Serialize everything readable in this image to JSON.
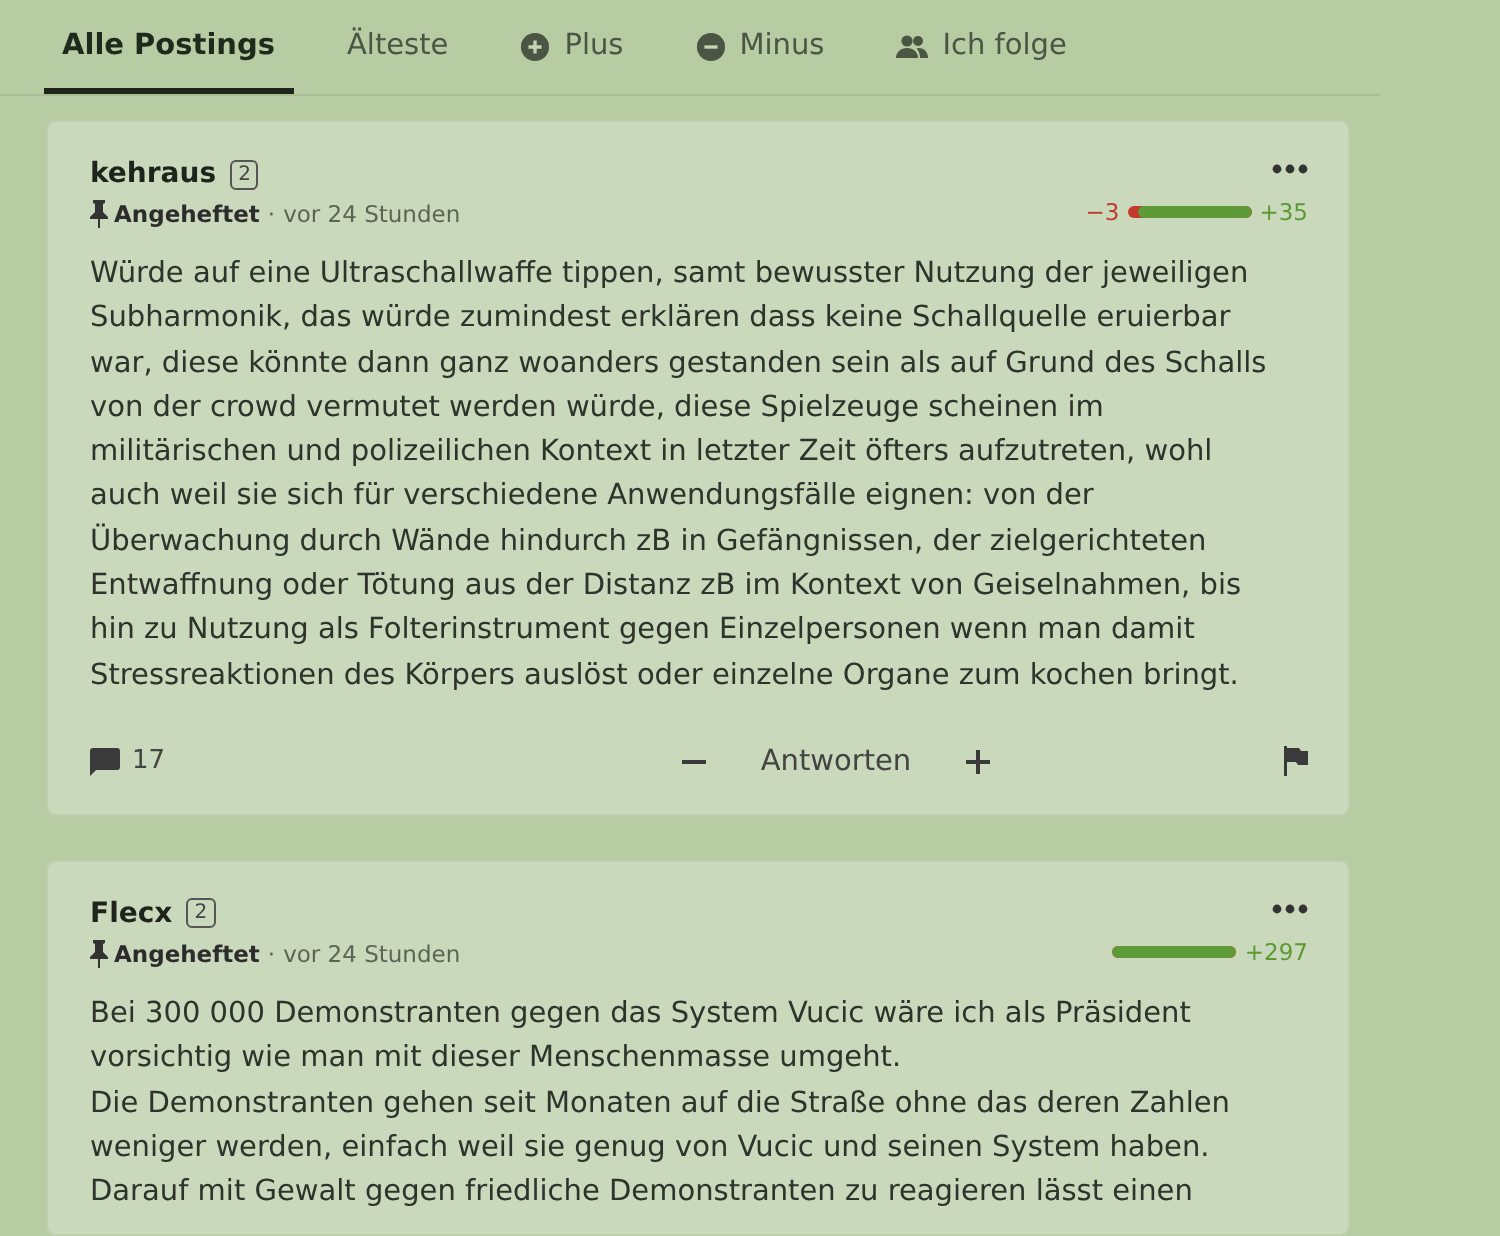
{
  "tabs": [
    {
      "label": "Alle Postings",
      "kind": "text",
      "selected": true
    },
    {
      "label": "Älteste",
      "kind": "text",
      "selected": false
    },
    {
      "label": "Plus",
      "kind": "plus",
      "selected": false
    },
    {
      "label": "Minus",
      "kind": "minus",
      "selected": false
    },
    {
      "label": "Ich folge",
      "kind": "people",
      "selected": false
    }
  ],
  "postings": [
    {
      "author": "kehraus",
      "badge": "2",
      "pinned": true,
      "pin_label": "Angeheftet",
      "separator": "·",
      "time": "vor 24 Stunden",
      "minus": "−3",
      "plus": "+35",
      "level": 0.92,
      "paragraphs": [
        "Würde auf eine Ultraschallwaffe tippen, samt bewusster Nutzung der jeweiligen Subharmonik, das würde zumindest erklären dass keine Schallquelle eruierbar war, diese könnte dann ganz woanders gestanden sein als auf Grund des Schalls von der crowd vermutet werden würde, diese Spielzeuge scheinen im militärischen und polizeilichen Kontext in letzter Zeit öfters aufzutreten, wohl auch weil sie sich für verschiedene Anwendungsfälle eignen: von der Überwachung durch Wände hindurch zB in Gefängnissen, der zielgerichteten Entwaffnung oder Tötung aus der Distanz zB im Kontext von Geiselnahmen, bis hin zu Nutzung als Folterinstrument gegen Einzelpersonen wenn man damit Stressreaktionen des Körpers auslöst oder einzelne Organe zum kochen bringt."
      ],
      "footer": {
        "comments": "17",
        "reply": "Antworten"
      }
    },
    {
      "author": "Flecx",
      "badge": "2",
      "pinned": true,
      "pin_label": "Angeheftet",
      "separator": "·",
      "time": "vor 24 Stunden",
      "plus": "+297",
      "level": 1,
      "paragraphs": [
        "Bei 300 000 Demonstranten gegen das System Vucic wäre ich als Präsident vorsichtig wie man mit dieser Menschenmasse umgeht.",
        "Die Demonstranten gehen seit Monaten auf die Straße ohne das deren Zahlen weniger werden, einfach weil sie genug von Vucic und seinen System haben.",
        "Darauf mit Gewalt gegen friedliche Demonstranten zu reagieren lässt einen"
      ]
    }
  ]
}
